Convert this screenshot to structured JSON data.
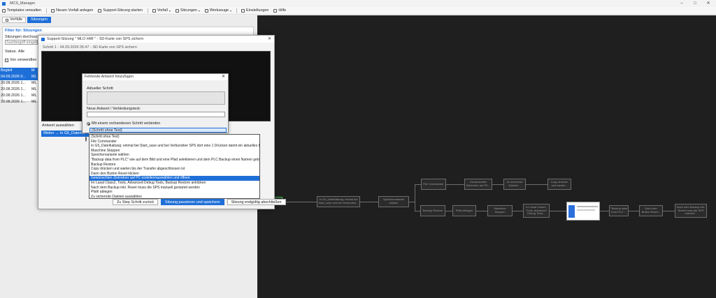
{
  "app": {
    "title": "MCS_Manager"
  },
  "window_controls": {
    "minimize": "–",
    "maximize": "□",
    "close": "✕"
  },
  "toolbar": {
    "items": [
      {
        "label": "Templates verwalten",
        "icon": "template-icon",
        "dropdown": false
      },
      {
        "label": "Neuen Vorfall anlegen",
        "icon": "new-file-icon",
        "dropdown": false
      },
      {
        "label": "Support-Sitzung starten",
        "icon": "play-icon",
        "dropdown": false
      },
      {
        "label": "Vorfall",
        "icon": "incident-icon",
        "dropdown": true
      },
      {
        "label": "Sitzungen",
        "icon": "sessions-icon",
        "dropdown": true
      },
      {
        "label": "Werkzeuge",
        "icon": "tools-icon",
        "dropdown": true
      },
      {
        "label": "Einstellungen",
        "icon": "settings-icon",
        "dropdown": false
      },
      {
        "label": "Hilfe",
        "icon": "help-icon",
        "dropdown": false
      }
    ]
  },
  "tabs": [
    {
      "label": "Vorfälle",
      "active": false
    },
    {
      "label": "Sitzungen",
      "active": true
    }
  ],
  "filter": {
    "title": "Filter für: Sitzungen",
    "subtitle": "Sitzungen durchsuche",
    "search_placeholder": "Suchbegriff eingeben",
    "status_label": "Status:",
    "status_value": "Alle",
    "checkbox_label": "Von verwendlen"
  },
  "sessions_table": {
    "headers": [
      "Begleit",
      "M"
    ],
    "rows": [
      {
        "date": "04.09.2026 0...",
        "code": "ML",
        "selected": true
      },
      {
        "date": "20.08.2026 1...",
        "code": "ML",
        "selected": false
      },
      {
        "date": "20.08.2026 1...",
        "code": "ML",
        "selected": false
      },
      {
        "date": "20.08.2026 1...",
        "code": "ML",
        "selected": false
      },
      {
        "date": "20.08.2026 1...",
        "code": "ML",
        "selected": false
      }
    ]
  },
  "session_dialog": {
    "title": "Support-Sitzung \" MLO HMI \" - SD-Karte von SPS sichern",
    "step": "Schritt 1 - 04.09.2026 05:47 - SD-Karte von SPS sichern",
    "answer_label": "Antwort auswählen:",
    "selected_answer": "Weiter → In G5_Dateihal",
    "buttons": {
      "back": "Zu Step Schritt zurück",
      "pause": "Sitzung pausieren und speichern",
      "end": "Sitzung endgültig abschließen"
    }
  },
  "add_answer_dialog": {
    "title": "Fehlende Antwort hinzufügen",
    "current_step_label": "Aktueller Schritt",
    "new_answer_label": "Neue Antwort / Verbindungstext:",
    "radio_existing": "Mit einem vorhandenen Schritt verbinden",
    "combo_value": "(Schritt ohne Text)"
  },
  "dropdown_options": [
    {
      "label": "(Schritt ohne Text)",
      "highlighted": false
    },
    {
      "label": "File Commander",
      "highlighted": false
    },
    {
      "label": "In G5_Dateihaltung: einmal bei Start_save und bei Verbundner SPS dort eine 1 Drücken damit ein aktuelles Backup",
      "highlighted": false
    },
    {
      "label": "Maschine Stoppen",
      "highlighted": false
    },
    {
      "label": "Speichervariante wählen",
      "highlighted": false
    },
    {
      "label": "\"Backup data from PLC\" wie auf dem Bild und eine Pfad selektieren und dem PLC Backup einen Namen geben",
      "highlighted": false
    },
    {
      "label": "Backup Restore",
      "highlighted": false
    },
    {
      "label": "Copy drücken und warten bis der Transfer abgeschlossen ist",
      "highlighted": false
    },
    {
      "label": "Dann den Button Reset klicken",
      "highlighted": false
    },
    {
      "label": "Gewünschten Zielordner auf PC erstellen/auswählen und öffnen",
      "highlighted": true
    },
    {
      "label": "Im Lasal Class2, Tools, Advanced Debug Tools, Backup Restore anklicken",
      "highlighted": false
    },
    {
      "label": "Nach dem Backup inkl. Reset muss die SPS manuell gestartet werden",
      "highlighted": false
    },
    {
      "label": "Pfahl ablegen",
      "highlighted": false
    },
    {
      "label": "Zu sichernde Dateien auswählen",
      "highlighted": false
    }
  ],
  "flow_nodes": [
    {
      "label": "In G5_Dateihaltung: einmal bei Start_save und bei Verbunden..."
    },
    {
      "label": "Speichervariante wählen"
    },
    {
      "label": "File Commander"
    },
    {
      "label": "Gewünschten Zielordner auf PC..."
    },
    {
      "label": "Zu sichernde Dateien..."
    },
    {
      "label": "Copy drücken und warten..."
    },
    {
      "label": "Backup Restore"
    },
    {
      "label": "Pfahl ablegen"
    },
    {
      "label": "Maschine Stoppen"
    },
    {
      "label": "Im Lasal Class2, Tools, Advanced Debug Tools..."
    },
    {
      "label": "\"Backup data from PLC\"..."
    },
    {
      "label": "Dann den Button Reset..."
    },
    {
      "label": "Nach dem Backup inkl. Reset muss die SPS manuell..."
    }
  ]
}
